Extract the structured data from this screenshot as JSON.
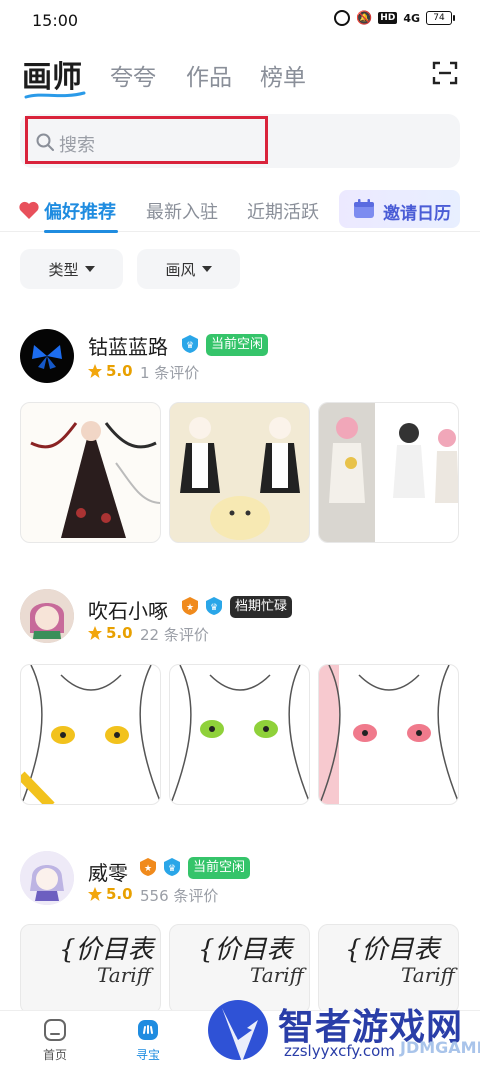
{
  "status_bar": {
    "time": "15:00",
    "network": "4G",
    "battery": "74"
  },
  "top_tabs": [
    {
      "label": "画师",
      "active": true
    },
    {
      "label": "夸夸",
      "active": false
    },
    {
      "label": "作品",
      "active": false
    },
    {
      "label": "榜单",
      "active": false
    }
  ],
  "search": {
    "placeholder": "搜索"
  },
  "sub_tabs": [
    {
      "label": "偏好推荐",
      "active": true
    },
    {
      "label": "最新入驻",
      "active": false
    },
    {
      "label": "近期活跃",
      "active": false
    }
  ],
  "invite_label": "邀请日历",
  "filters": [
    {
      "label": "类型"
    },
    {
      "label": "画风"
    }
  ],
  "artists": [
    {
      "name": "钴蓝蓝路",
      "status": "当前空闲",
      "status_color": "#35c46a",
      "rating": "5.0",
      "reviews": "1 条评价",
      "thumb_theme": "gothic"
    },
    {
      "name": "吹石小啄",
      "status": "档期忙碌",
      "status_color": "#2b2b2b",
      "rating": "5.0",
      "reviews": "22 条评价",
      "thumb_theme": "sketch"
    },
    {
      "name": "威零",
      "status": "当前空闲",
      "status_color": "#35c46a",
      "rating": "5.0",
      "reviews": "556 条评价",
      "thumb_theme": "tariff"
    }
  ],
  "tariff_text": {
    "line1": "{价目表",
    "line2": "Tariff"
  },
  "bottom_nav": [
    {
      "label": "首页",
      "icon": "home-icon",
      "active": false
    },
    {
      "label": "寻宝",
      "icon": "treasure-icon",
      "active": true
    }
  ],
  "watermark": {
    "title": "智者游戏网",
    "url": "zzslyyxcfy.com",
    "url2": "JDMGAME"
  },
  "colors": {
    "accent": "#1f8ce0",
    "highlight_border": "#d9233b",
    "rating": "#e8a000"
  }
}
